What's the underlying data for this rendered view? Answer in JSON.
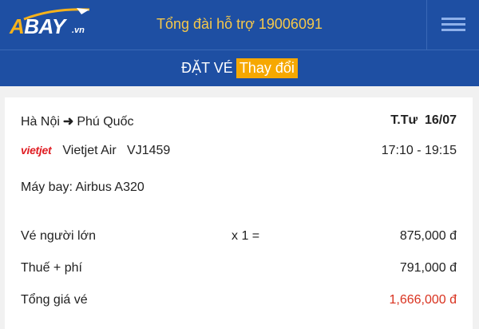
{
  "header": {
    "logo_main": "BAY",
    "logo_a": "A",
    "logo_suffix": ".vn",
    "hotline": "Tổng đài hỗ trợ 19006091",
    "menu_icon": "hamburger-menu-icon"
  },
  "subheader": {
    "title": "ĐẶT VÉ",
    "change_label": "Thay đổi"
  },
  "trip": {
    "from": "Hà Nội",
    "to": "Phú Quốc",
    "day": "T.Tư",
    "date": "16/07",
    "airline_logo": "vietjet",
    "airline": "Vietjet Air",
    "flight_no": "VJ1459",
    "time": "17:10 - 19:15",
    "aircraft": "Máy bay: Airbus A320"
  },
  "pricing": {
    "adult_label": "Vé người lớn",
    "adult_qty": "x 1 =",
    "adult_price": "875,000 đ",
    "tax_label": "Thuế + phí",
    "tax_price": "791,000 đ",
    "total_label": "Tổng giá vé",
    "total_price": "1,666,000 đ"
  },
  "colors": {
    "brand_blue": "#1e4fa3",
    "accent_orange": "#f6a800",
    "hotline_yellow": "#f6c84a",
    "total_red": "#d9321f"
  }
}
